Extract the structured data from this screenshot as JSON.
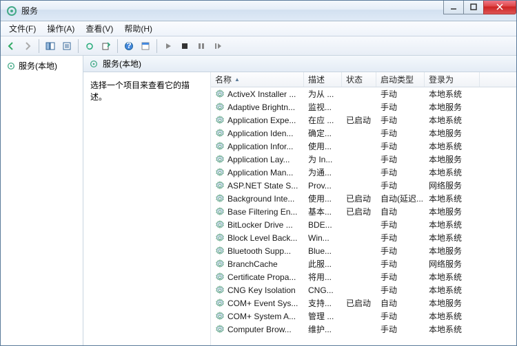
{
  "window": {
    "title": "服务"
  },
  "menu": {
    "file": "文件(F)",
    "action": "操作(A)",
    "view": "查看(V)",
    "help": "帮助(H)"
  },
  "tree": {
    "root": "服务(本地)"
  },
  "pane": {
    "title": "服务(本地)",
    "desc_prompt": "选择一个项目来查看它的描述。"
  },
  "columns": {
    "name": "名称",
    "desc": "描述",
    "status": "状态",
    "startup": "启动类型",
    "logon": "登录为"
  },
  "services": [
    {
      "name": "ActiveX Installer ...",
      "desc": "为从 ...",
      "status": "",
      "startup": "手动",
      "logon": "本地系统"
    },
    {
      "name": "Adaptive Brightn...",
      "desc": "监视...",
      "status": "",
      "startup": "手动",
      "logon": "本地服务"
    },
    {
      "name": "Application Expe...",
      "desc": "在应 ...",
      "status": "已启动",
      "startup": "手动",
      "logon": "本地系统"
    },
    {
      "name": "Application Iden...",
      "desc": "确定...",
      "status": "",
      "startup": "手动",
      "logon": "本地服务"
    },
    {
      "name": "Application Infor...",
      "desc": "使用...",
      "status": "",
      "startup": "手动",
      "logon": "本地系统"
    },
    {
      "name": "Application Lay...",
      "desc": "为 In...",
      "status": "",
      "startup": "手动",
      "logon": "本地服务"
    },
    {
      "name": "Application Man...",
      "desc": "为通...",
      "status": "",
      "startup": "手动",
      "logon": "本地系统"
    },
    {
      "name": "ASP.NET State S...",
      "desc": "Prov...",
      "status": "",
      "startup": "手动",
      "logon": "网络服务"
    },
    {
      "name": "Background Inte...",
      "desc": "使用...",
      "status": "已启动",
      "startup": "自动(延迟...",
      "logon": "本地系统"
    },
    {
      "name": "Base Filtering En...",
      "desc": "基本...",
      "status": "已启动",
      "startup": "自动",
      "logon": "本地服务"
    },
    {
      "name": "BitLocker Drive ...",
      "desc": "BDE...",
      "status": "",
      "startup": "手动",
      "logon": "本地系统"
    },
    {
      "name": "Block Level Back...",
      "desc": "Win...",
      "status": "",
      "startup": "手动",
      "logon": "本地系统"
    },
    {
      "name": "Bluetooth Supp...",
      "desc": "Blue...",
      "status": "",
      "startup": "手动",
      "logon": "本地服务"
    },
    {
      "name": "BranchCache",
      "desc": "此服...",
      "status": "",
      "startup": "手动",
      "logon": "网络服务"
    },
    {
      "name": "Certificate Propa...",
      "desc": "将用...",
      "status": "",
      "startup": "手动",
      "logon": "本地系统"
    },
    {
      "name": "CNG Key Isolation",
      "desc": "CNG...",
      "status": "",
      "startup": "手动",
      "logon": "本地系统"
    },
    {
      "name": "COM+ Event Sys...",
      "desc": "支持...",
      "status": "已启动",
      "startup": "自动",
      "logon": "本地服务"
    },
    {
      "name": "COM+ System A...",
      "desc": "管理 ...",
      "status": "",
      "startup": "手动",
      "logon": "本地系统"
    },
    {
      "name": "Computer Brow...",
      "desc": "维护...",
      "status": "",
      "startup": "手动",
      "logon": "本地系统"
    }
  ]
}
